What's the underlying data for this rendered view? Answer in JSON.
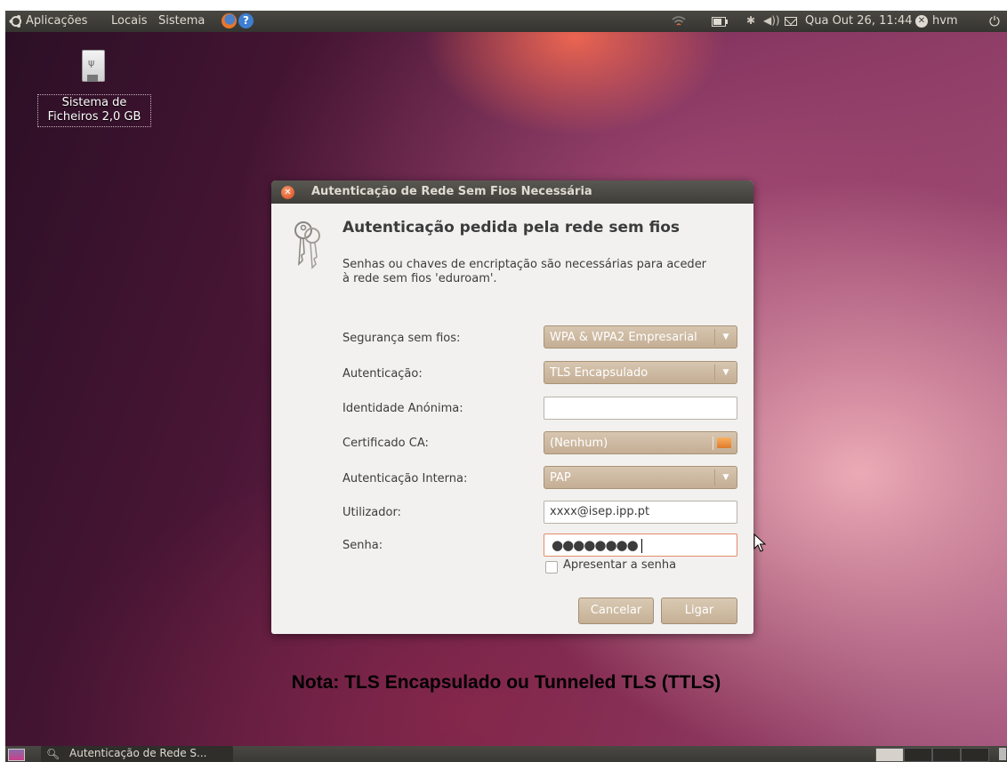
{
  "top_panel": {
    "menus": [
      "Aplicações",
      "Locais",
      "Sistema"
    ],
    "icons": [
      "ubuntu-logo-icon",
      "firefox-icon",
      "help-icon",
      "network-icon",
      "battery-icon",
      "bluetooth-icon",
      "volume-icon",
      "mail-icon",
      "user-icon",
      "power-icon"
    ],
    "clock": "Qua Out 26, 11:44",
    "user": "hvm"
  },
  "desktop": {
    "drive_icon": "usb-drive-icon",
    "drive_label_line1": "Sistema de",
    "drive_label_line2": "Ficheiros 2,0 GB"
  },
  "dialog": {
    "title": "Autenticação de Rede Sem Fios Necessária",
    "heading": "Autenticação pedida pela rede sem fios",
    "description": "Senhas ou chaves de encriptação são necessárias para aceder à rede sem fios 'eduroam'.",
    "fields": {
      "security_label": "Segurança sem fios:",
      "security_value": "WPA & WPA2 Empresarial",
      "auth_label": "Autenticação:",
      "auth_value": "TLS Encapsulado",
      "anon_identity_label": "Identidade Anónima:",
      "anon_identity_value": "",
      "ca_cert_label": "Certificado CA:",
      "ca_cert_value": "(Nenhum)",
      "inner_auth_label": "Autenticação Interna:",
      "inner_auth_value": "PAP",
      "user_label": "Utilizador:",
      "user_value": "xxxx@isep.ipp.pt",
      "password_label": "Senha:",
      "password_value": "●●●●●●●●"
    },
    "show_password_label": "Apresentar a senha",
    "show_password_checked": false,
    "cancel_label": "Cancelar",
    "connect_label": "Ligar"
  },
  "note": "Nota: TLS Encapsulado ou Tunneled TLS (TTLS)",
  "bottom_panel": {
    "task_label": "Autenticação de Rede S..."
  },
  "colors": {
    "panel": "#3a3935",
    "dialog_bg": "#f2f1f0",
    "button": "#c9b59a",
    "focus_border": "#e58b6b"
  }
}
